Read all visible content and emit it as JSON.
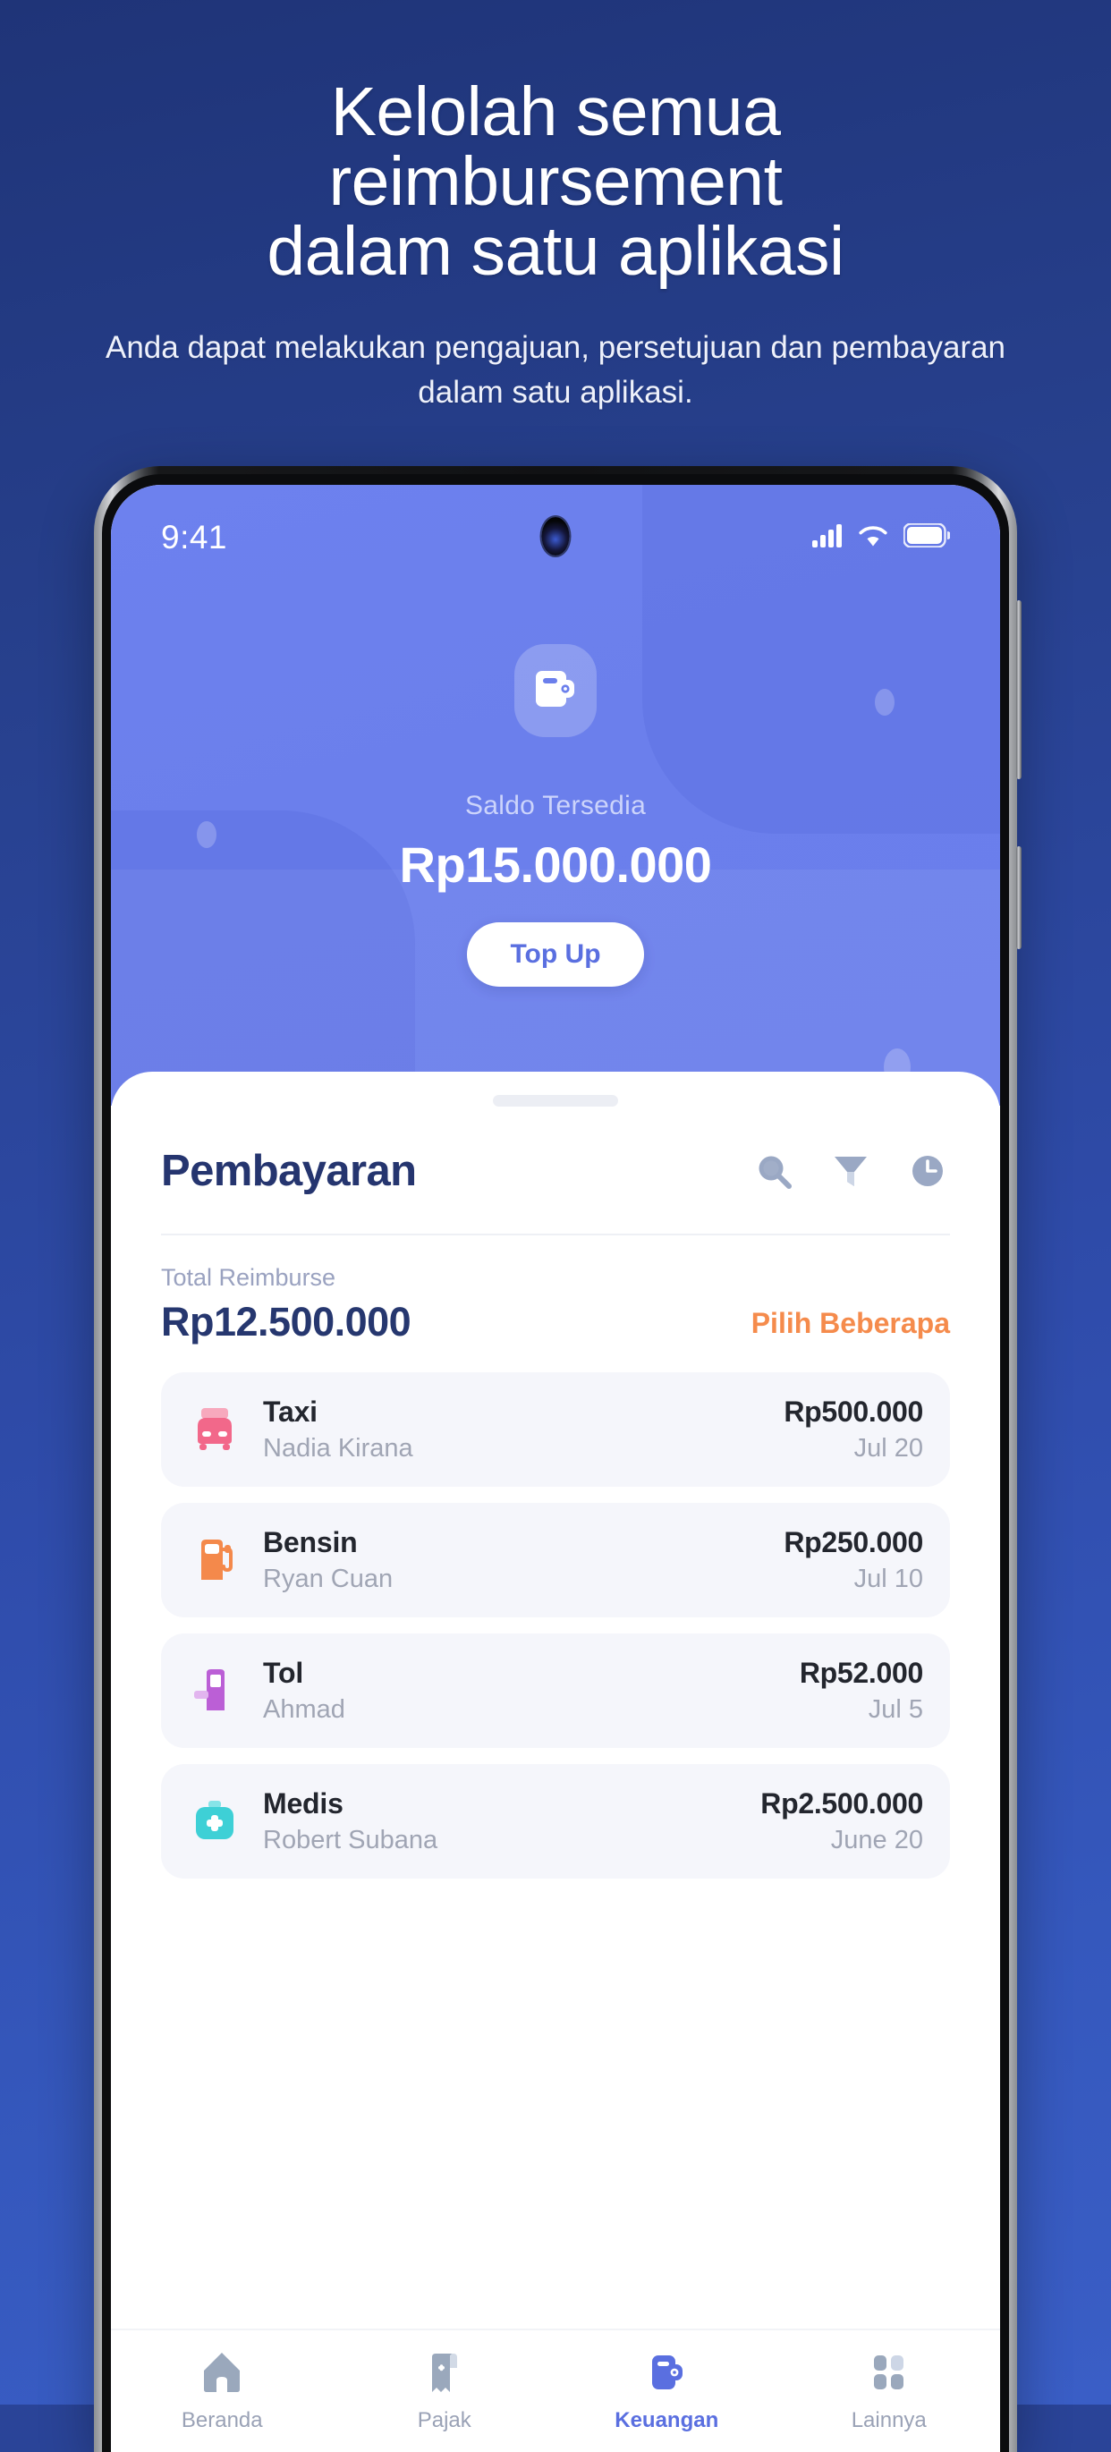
{
  "promo": {
    "headline": "Kelolah semua\nreimbursement\ndalam satu aplikasi",
    "subheadline": "Anda dapat melakukan pengajuan, persetujuan dan pembayaran dalam satu aplikasi.",
    "background_color": "#2f4cab"
  },
  "phone": {
    "status_bar": {
      "time": "9:41",
      "signal_icon": "cellular-signal-icon",
      "wifi_icon": "wifi-icon",
      "battery_icon": "battery-full-icon"
    },
    "wallet_header": {
      "background_color": "#6b7fec",
      "wallet_icon": "wallet-icon",
      "balance_label": "Saldo Tersedia",
      "balance_amount": "Rp15.000.000",
      "topup_label": "Top Up",
      "topup_text_color": "#5a6fe0"
    },
    "sheet": {
      "title": "Pembayaran",
      "actions": [
        {
          "name": "search-icon",
          "label": "Cari"
        },
        {
          "name": "filter-icon",
          "label": "Filter"
        },
        {
          "name": "history-clock-icon",
          "label": "Riwayat"
        }
      ],
      "summary": {
        "total_label": "Total Reimburse",
        "total_amount": "Rp12.500.000",
        "total_color": "#26376f",
        "select_multiple_label": "Pilih Beberapa",
        "select_multiple_color": "#f58b4c"
      },
      "transactions": [
        {
          "icon": "taxi-icon",
          "icon_color": "#f2688a",
          "category": "Taxi",
          "person": "Nadia Kirana",
          "amount": "Rp500.000",
          "date": "Jul 20"
        },
        {
          "icon": "fuel-pump-icon",
          "icon_color": "#f4894b",
          "category": "Bensin",
          "person": "Ryan Cuan",
          "amount": "Rp250.000",
          "date": "Jul 10"
        },
        {
          "icon": "toll-booth-icon",
          "icon_color": "#bb5fd6",
          "category": "Tol",
          "person": "Ahmad",
          "amount": "Rp52.000",
          "date": "Jul 5"
        },
        {
          "icon": "medical-kit-icon",
          "icon_color": "#3ed0d6",
          "category": "Medis",
          "person": "Robert Subana",
          "amount": "Rp2.500.000",
          "date": "June 20"
        }
      ]
    },
    "bottom_nav": {
      "active_color": "#5a6fe0",
      "inactive_color": "#9aa2b6",
      "items": [
        {
          "icon": "home-icon",
          "label": "Beranda",
          "active": false
        },
        {
          "icon": "receipt-add-icon",
          "label": "Pajak",
          "active": false
        },
        {
          "icon": "wallet-icon",
          "label": "Keuangan",
          "active": true
        },
        {
          "icon": "grid-menu-icon",
          "label": "Lainnya",
          "active": false
        }
      ]
    }
  }
}
